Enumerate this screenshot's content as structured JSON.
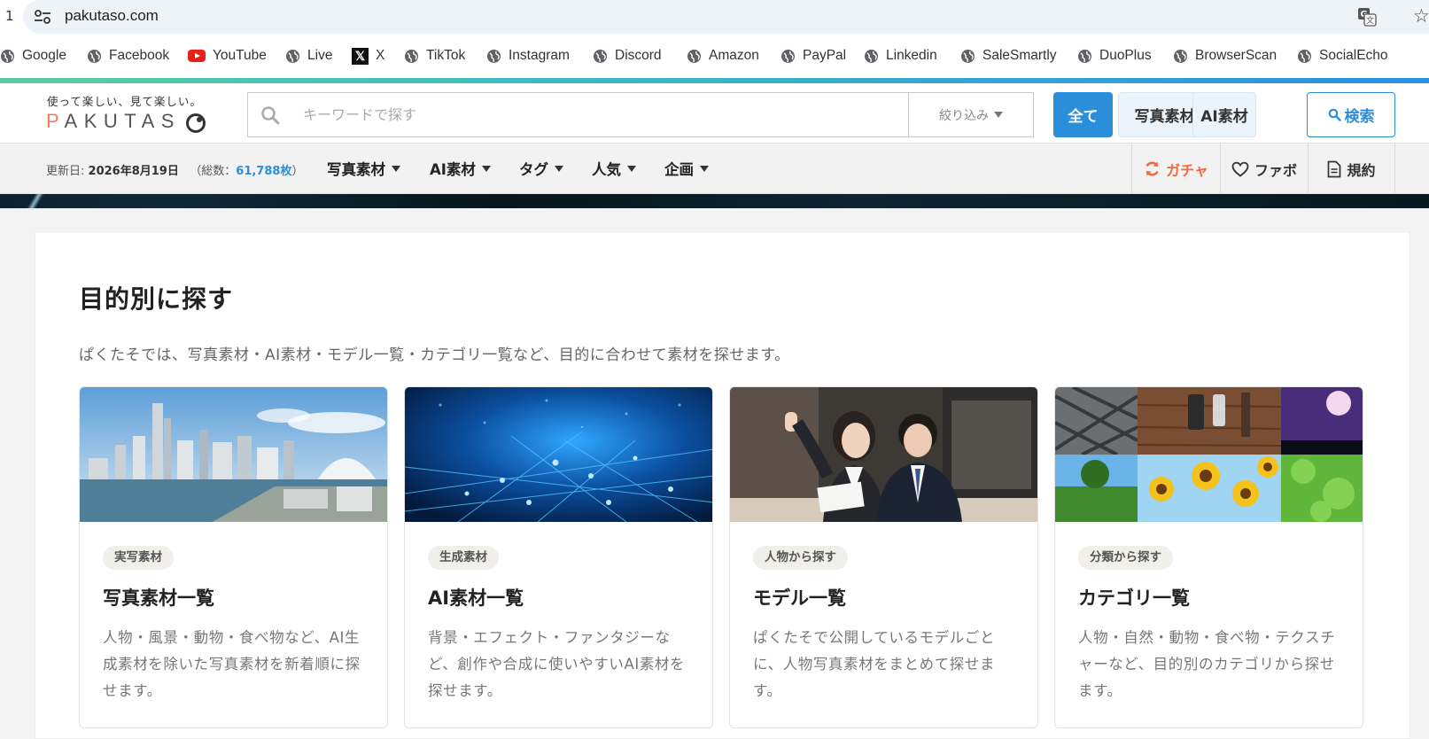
{
  "browser": {
    "tab_number": "1",
    "url": "pakutaso.com"
  },
  "bookmarks": [
    {
      "label": "Google",
      "icon": "globe-icon"
    },
    {
      "label": "Facebook",
      "icon": "globe-icon"
    },
    {
      "label": "YouTube",
      "icon": "youtube-icon"
    },
    {
      "label": "Live",
      "icon": "globe-icon"
    },
    {
      "label": "X",
      "icon": "x-icon"
    },
    {
      "label": "TikTok",
      "icon": "globe-icon"
    },
    {
      "label": "Instagram",
      "icon": "globe-icon"
    },
    {
      "label": "Discord",
      "icon": "globe-icon"
    },
    {
      "label": "Amazon",
      "icon": "globe-icon"
    },
    {
      "label": "PayPal",
      "icon": "globe-icon"
    },
    {
      "label": "Linkedin",
      "icon": "globe-icon"
    },
    {
      "label": "SaleSmartly",
      "icon": "globe-icon"
    },
    {
      "label": "DuoPlus",
      "icon": "globe-icon"
    },
    {
      "label": "BrowserScan",
      "icon": "globe-icon"
    },
    {
      "label": "SocialEcho",
      "icon": "globe-icon"
    }
  ],
  "header": {
    "logo_tagline": "使って楽しい、見て楽しい。",
    "logo_text_accent": "P",
    "logo_text": "AKUTAS",
    "search_placeholder": "キーワードで探す",
    "filter_label": "絞り込み",
    "btn_all": "全て",
    "btn_photo": "写真素材",
    "btn_ai": "AI素材",
    "btn_search": "検索"
  },
  "subnav": {
    "updated_label": "更新日:",
    "updated_date": "2026年8月19日",
    "total_prefix": "（総数：",
    "total_count": "61,788枚",
    "total_suffix": "）",
    "items": [
      "写真素材",
      "AI素材",
      "タグ",
      "人気",
      "企画"
    ],
    "gacha": "ガチャ",
    "favorites": "ファボ",
    "terms": "規約"
  },
  "main": {
    "title": "目的別に探す",
    "description": "ぱくたそでは、写真素材・AI素材・モデル一覧・カテゴリ一覧など、目的に合わせて素材を探せます。",
    "cards": [
      {
        "badge": "実写素材",
        "title": "写真素材一覧",
        "desc": "人物・風景・動物・食べ物など、AI生成素材を除いた写真素材を新着順に探せます。"
      },
      {
        "badge": "生成素材",
        "title": "AI素材一覧",
        "desc": "背景・エフェクト・ファンタジーなど、創作や合成に使いやすいAI素材を探せます。"
      },
      {
        "badge": "人物から探す",
        "title": "モデル一覧",
        "desc": "ぱくたそで公開しているモデルごとに、人物写真素材をまとめて探せます。"
      },
      {
        "badge": "分類から探す",
        "title": "カテゴリ一覧",
        "desc": "人物・自然・動物・食べ物・テクスチャーなど、目的別のカテゴリから探せます。"
      }
    ]
  },
  "colors": {
    "accent_blue": "#2b8ed8",
    "gacha_orange": "#f06a3e",
    "logo_orange": "#f07c5d"
  }
}
